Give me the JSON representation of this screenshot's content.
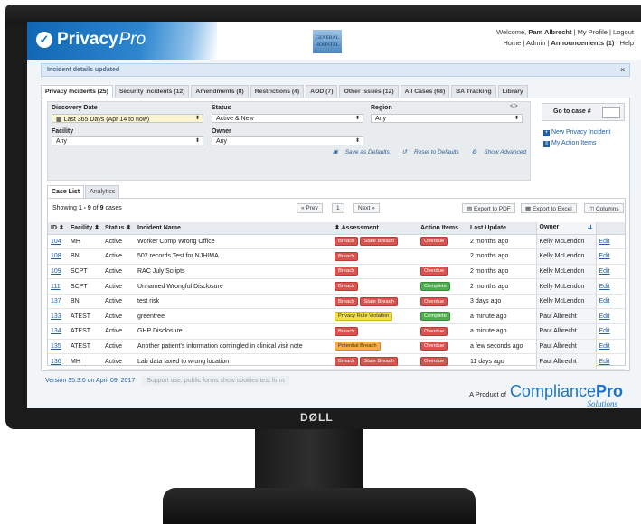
{
  "header": {
    "brand_main": "Privacy",
    "brand_sub": "Pro",
    "hospital_line1": "GENERAL",
    "hospital_line2": "HOSPITAL",
    "welcome_prefix": "Welcome,",
    "user_name": "Pam Albrecht",
    "my_profile": "My Profile",
    "logout": "Logout",
    "home": "Home",
    "admin": "Admin",
    "announcements": "Announcements (1)",
    "help": "Help"
  },
  "notice": {
    "text": "Incident details updated",
    "close": "×"
  },
  "tabs": [
    {
      "label": "Privacy Incidents (25)"
    },
    {
      "label": "Security Incidents (12)"
    },
    {
      "label": "Amendments (8)"
    },
    {
      "label": "Restrictions (4)"
    },
    {
      "label": "AOD (7)"
    },
    {
      "label": "Other Issues (12)"
    },
    {
      "label": "All Cases (68)"
    },
    {
      "label": "BA Tracking"
    },
    {
      "label": "Library"
    }
  ],
  "filters": {
    "discovery_label": "Discovery Date",
    "discovery_value": "Last 365 Days (Apr 14 to now)",
    "status_label": "Status",
    "status_value": "Active & New",
    "region_label": "Region",
    "region_value": "Any",
    "facility_label": "Facility",
    "facility_value": "Any",
    "owner_label": "Owner",
    "owner_value": "Any",
    "save_defaults": "Save as Defaults",
    "reset_defaults": "Reset to Defaults",
    "show_advanced": "Show Advanced",
    "code_icon": "</>"
  },
  "sidebar": {
    "goto_label": "Go to case #",
    "new_incident": "New Privacy Incident",
    "my_actions": "My Action Items"
  },
  "subtabs": [
    {
      "label": "Case List"
    },
    {
      "label": "Analytics"
    }
  ],
  "list": {
    "showing_prefix": "Showing",
    "showing_range": "1 - 9",
    "showing_of": "of",
    "showing_total": "9",
    "showing_suffix": "cases",
    "prev": "« Prev",
    "page": "1",
    "next": "Next »",
    "export_pdf": "Export to PDF",
    "export_excel": "Export to Excel",
    "columns": "Columns"
  },
  "columns": [
    "ID",
    "Facility",
    "Status",
    "Incident Name",
    "Assessment",
    "Action Items",
    "Last Update",
    "Owner",
    ""
  ],
  "rows": [
    {
      "id": "104",
      "facility": "MH",
      "status": "Active",
      "name": "Worker Comp Wrong Office",
      "assessment": [
        [
          "Breach",
          "red"
        ],
        [
          "State Breach",
          "red"
        ]
      ],
      "action": [
        "Overdue",
        "red"
      ],
      "updated": "2 months ago",
      "owner": "Kelly McLendon",
      "edit": "Edit"
    },
    {
      "id": "108",
      "facility": "BN",
      "status": "Active",
      "name": "502 records Test for NJHIMA",
      "assessment": [
        [
          "Breach",
          "red"
        ]
      ],
      "action": null,
      "updated": "2 months ago",
      "owner": "Kelly McLendon",
      "edit": "Edit"
    },
    {
      "id": "109",
      "facility": "SCPT",
      "status": "Active",
      "name": "RAC July Scripts",
      "assessment": [
        [
          "Breach",
          "red"
        ]
      ],
      "action": [
        "Overdue",
        "red"
      ],
      "updated": "2 months ago",
      "owner": "Kelly McLendon",
      "edit": "Edit"
    },
    {
      "id": "111",
      "facility": "SCPT",
      "status": "Active",
      "name": "Unnamed Wrongful Disclosure",
      "assessment": [
        [
          "Breach",
          "red"
        ]
      ],
      "action": [
        "Complete",
        "green"
      ],
      "updated": "2 months ago",
      "owner": "Kelly McLendon",
      "edit": "Edit"
    },
    {
      "id": "137",
      "facility": "BN",
      "status": "Active",
      "name": "test risk",
      "assessment": [
        [
          "Breach",
          "red"
        ],
        [
          "State Breach",
          "red"
        ]
      ],
      "action": [
        "Overdue",
        "red"
      ],
      "updated": "3 days ago",
      "owner": "Kelly McLendon",
      "edit": "Edit"
    },
    {
      "id": "133",
      "facility": "ATEST",
      "status": "Active",
      "name": "greentree",
      "assessment": [
        [
          "Privacy Rule Violation",
          "yellow"
        ]
      ],
      "action": [
        "Complete",
        "green"
      ],
      "updated": "a minute ago",
      "owner": "Paul Albrecht",
      "edit": "Edit"
    },
    {
      "id": "134",
      "facility": "ATEST",
      "status": "Active",
      "name": "GHP Disclosure",
      "assessment": [
        [
          "Breach",
          "red"
        ]
      ],
      "action": [
        "Overdue",
        "red"
      ],
      "updated": "a minute ago",
      "owner": "Paul Albrecht",
      "edit": "Edit"
    },
    {
      "id": "135",
      "facility": "ATEST",
      "status": "Active",
      "name": "Another patient's information comingled in clinical visit note",
      "assessment": [
        [
          "Potential Breach",
          "orange"
        ]
      ],
      "action": [
        "Overdue",
        "red"
      ],
      "updated": "a few seconds ago",
      "owner": "Paul Albrecht",
      "edit": "Edit"
    },
    {
      "id": "136",
      "facility": "MH",
      "status": "Active",
      "name": "Lab data faxed to wrong location",
      "assessment": [
        [
          "Breach",
          "red"
        ],
        [
          "State Breach",
          "red"
        ]
      ],
      "action": [
        "Overdue",
        "red"
      ],
      "updated": "11 days ago",
      "owner": "Paul Albrecht",
      "edit": "Edit"
    }
  ],
  "footer": {
    "version": "Version 35.3.0 on April 09, 2017",
    "support": "Support use:  public forms    show cookies    test form",
    "product_prefix": "A Product of",
    "cp_main": "Compliance",
    "cp_bold": "Pro",
    "solutions": "Solutions",
    "monitor_brand": "DØLL"
  },
  "colors": {
    "brand_blue": "#1b74c2",
    "breach_red": "#d9534f",
    "complete_green": "#4cae4c",
    "violation_yellow": "#f0e046",
    "potential_orange": "#f5ad4e"
  },
  "icons": [
    "check-circle-icon",
    "calendar-icon",
    "chevron-icon",
    "code-icon",
    "save-icon",
    "reset-icon",
    "gear-icon",
    "plus-icon",
    "list-icon",
    "pdf-icon",
    "excel-icon",
    "columns-icon",
    "sort-icon",
    "filter-icon",
    "close-icon"
  ]
}
